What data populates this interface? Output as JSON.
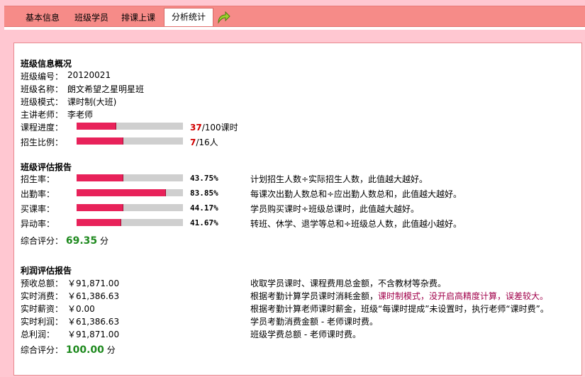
{
  "tabs": [
    {
      "label": "基本信息"
    },
    {
      "label": "班级学员"
    },
    {
      "label": "排课上课"
    },
    {
      "label": "分析统计"
    }
  ],
  "overview": {
    "title": "班级信息概况",
    "rows": [
      {
        "label": "班级编号：",
        "value": "20120021"
      },
      {
        "label": "班级名称：",
        "value": "朗文希望之星明星班"
      },
      {
        "label": "班级模式：",
        "value": "课时制(大班)"
      },
      {
        "label": "主讲老师：",
        "value": "李老师"
      }
    ],
    "progress": {
      "label": "课程进度：",
      "done": "37",
      "total": "/100课时",
      "fraction": 0.37
    },
    "enroll": {
      "label": "招生比例：",
      "done": "7",
      "total": "/16人",
      "fraction": 0.4375
    }
  },
  "evaluation": {
    "title": "班级评估报告",
    "rows": [
      {
        "label": "招生率：",
        "pct": "43.75%",
        "fraction": 0.4375,
        "desc": "计划招生人数÷实际招生人数，此值越大越好。"
      },
      {
        "label": "出勤率：",
        "pct": "83.85%",
        "fraction": 0.8385,
        "desc": "每课次出勤人数总和÷应出勤人数总和，此值越大越好。"
      },
      {
        "label": "买课率：",
        "pct": "44.17%",
        "fraction": 0.4417,
        "desc": "学员购买课时÷班级总课时，此值越大越好。"
      },
      {
        "label": "异动率：",
        "pct": "41.67%",
        "fraction": 0.4167,
        "desc": "转班、休学、退学等总和÷班级总人数，此值越小越好。"
      }
    ],
    "score_label": "综合评分：",
    "score": "69.35",
    "score_unit": "分"
  },
  "profit": {
    "title": "利润评估报告",
    "rows": [
      {
        "label": "预收总额：",
        "value": "￥91,871.00",
        "desc": "收取学员课时、课程费用总金额，不含教材等杂费。"
      },
      {
        "label": "实时消费：",
        "value": "￥61,386.63",
        "desc_pre": "根据考勤计算学员课时消耗金额，",
        "desc_hl": "课时制模式，没开启高精度计算，误差较大。"
      },
      {
        "label": "实时薪资：",
        "value": "￥0.00",
        "desc": "根据考勤计算老师课时薪金，班级“每课时提成”未设置时，执行老师“课时费”。"
      },
      {
        "label": "实时利润：",
        "value": "￥61,386.63",
        "desc": "学员考勤消费金额 - 老师课时费。"
      },
      {
        "label": "总利润：",
        "value": "￥91,871.00",
        "desc": "班级学费总额 - 老师课时费。"
      }
    ],
    "score_label": "综合评分：",
    "score": "100.00",
    "score_unit": "分"
  },
  "colors": {
    "bar_fill": "#e8225a",
    "bar_track": "#cfcfcf",
    "score_green": "#1f8a1f",
    "highlight": "#a0004a",
    "accent_red": "#d10000"
  },
  "icons": {
    "refresh": "refresh-arrow-icon"
  }
}
